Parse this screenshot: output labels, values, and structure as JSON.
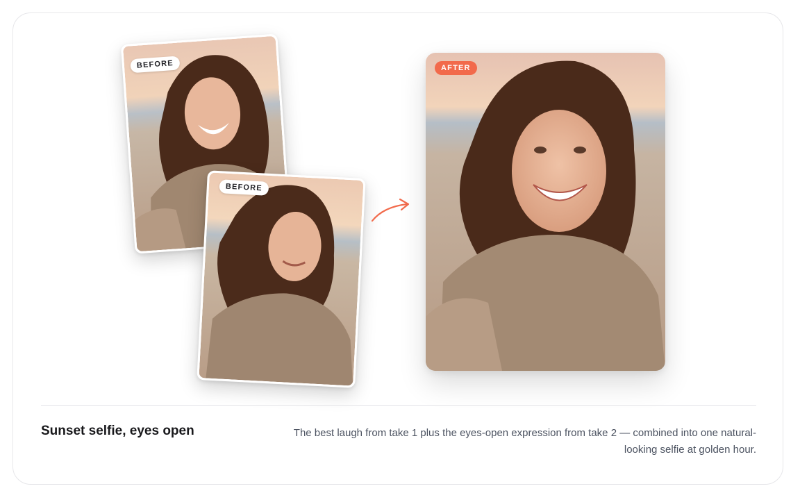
{
  "before_label": "BEFORE",
  "after_label": "AFTER",
  "caption": {
    "title": "Sunset selfie, eyes open",
    "description": "The best laugh from take 1 plus the eyes-open expression from take 2 — combined into one natural-looking selfie at golden hour."
  },
  "colors": {
    "accent": "#f26a4b",
    "title_text": "#18181b",
    "body_text": "#4b5260"
  },
  "icons": {
    "transition": "curved-arrow-icon"
  }
}
